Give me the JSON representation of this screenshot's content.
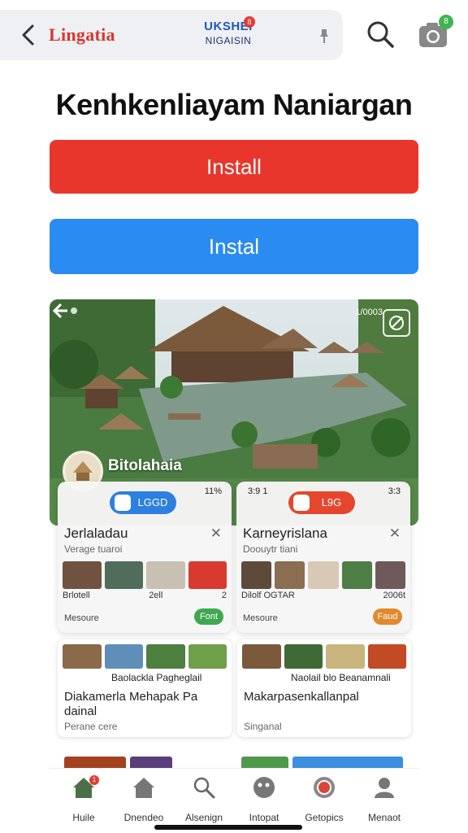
{
  "topbar": {
    "brand": "Lingatia",
    "logo_line1": "UKSHEI",
    "logo_line2": "NIGAISIN",
    "logo_badge": "8",
    "camera_badge": "8"
  },
  "page": {
    "title": "Kenhkenliayam Naniargan",
    "install_red": "Install",
    "install_blue": "Instal"
  },
  "hero": {
    "count": "1/0003",
    "name": "Bitolahaia"
  },
  "cards": [
    {
      "status_left": "",
      "status_right": "11%",
      "pill": "LGGD",
      "title": "Jerlaladau",
      "subtitle": "Verage tuaroi",
      "captions": [
        "Brlotell",
        "2ell",
        "2"
      ],
      "footer": "Mesoure",
      "button": "Font",
      "button_color": "#3fa84f"
    },
    {
      "status_left": "3:9 1",
      "status_right": "3:3",
      "pill": "L9G",
      "title": "Karneyrislana",
      "subtitle": "Doouytr tiani",
      "captions": [
        "Dilolf OGTAR",
        "",
        "2006t"
      ],
      "footer": "Mesoure",
      "button": "Faud",
      "button_color": "#e08a2c"
    }
  ],
  "lower_cards": [
    {
      "captions": "Baolackla  Pagheglail",
      "title": "Diakamerla Mehapak  Pa dainal",
      "subtitle": "Perane cere"
    },
    {
      "captions": "Naolail blo  Beanamnali",
      "title": "Makarpasenkallanpal",
      "subtitle": "Singanal"
    }
  ],
  "bottom_nav": [
    {
      "label": "Huile",
      "icon": "home-icon",
      "badge": "1"
    },
    {
      "label": "Dnendeo",
      "icon": "house-icon"
    },
    {
      "label": "Alsenign",
      "icon": "search-icon"
    },
    {
      "label": "Intopat",
      "icon": "face-icon"
    },
    {
      "label": "Getopics",
      "icon": "record-icon"
    },
    {
      "label": "Menaot",
      "icon": "person-icon"
    }
  ]
}
